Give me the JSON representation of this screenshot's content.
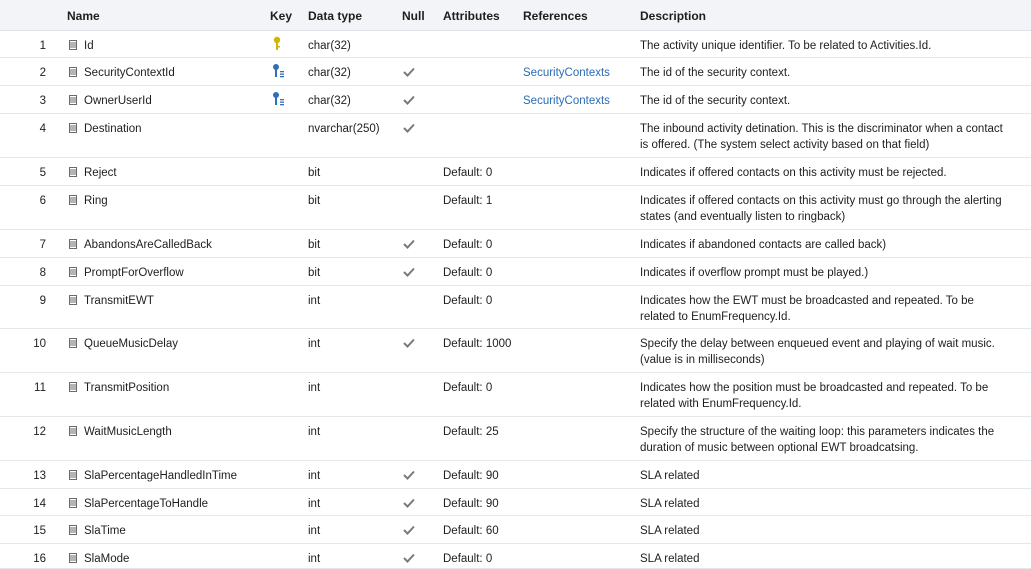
{
  "headers": {
    "name": "Name",
    "key": "Key",
    "data_type": "Data type",
    "null": "Null",
    "attributes": "Attributes",
    "references": "References",
    "description": "Description"
  },
  "rows": [
    {
      "num": "1",
      "name": "Id",
      "key": "primary",
      "type": "char(32)",
      "null": false,
      "attr": "",
      "ref": "",
      "desc": "The activity unique identifier. To be related to Activities.Id."
    },
    {
      "num": "2",
      "name": "SecurityContextId",
      "key": "foreign",
      "type": "char(32)",
      "null": true,
      "attr": "",
      "ref": "SecurityContexts",
      "desc": "The id of the security context."
    },
    {
      "num": "3",
      "name": "OwnerUserId",
      "key": "foreign",
      "type": "char(32)",
      "null": true,
      "attr": "",
      "ref": "SecurityContexts",
      "desc": "The id of the security context."
    },
    {
      "num": "4",
      "name": "Destination",
      "key": "",
      "type": "nvarchar(250)",
      "null": true,
      "attr": "",
      "ref": "",
      "desc": "The inbound activity detination. This is the discriminator when a contact is offered. (The system select activity based on that field)"
    },
    {
      "num": "5",
      "name": "Reject",
      "key": "",
      "type": "bit",
      "null": false,
      "attr": "Default: 0",
      "ref": "",
      "desc": "Indicates if offered contacts on this activity must be rejected."
    },
    {
      "num": "6",
      "name": "Ring",
      "key": "",
      "type": "bit",
      "null": false,
      "attr": "Default: 1",
      "ref": "",
      "desc": "Indicates if offered contacts on this activity must go through the alerting states (and eventually listen to ringback)"
    },
    {
      "num": "7",
      "name": "AbandonsAreCalledBack",
      "key": "",
      "type": "bit",
      "null": true,
      "attr": "Default: 0",
      "ref": "",
      "desc": "Indicates if abandoned contacts are called back)"
    },
    {
      "num": "8",
      "name": "PromptForOverflow",
      "key": "",
      "type": "bit",
      "null": true,
      "attr": "Default: 0",
      "ref": "",
      "desc": "Indicates if overflow prompt must be played.)"
    },
    {
      "num": "9",
      "name": "TransmitEWT",
      "key": "",
      "type": "int",
      "null": false,
      "attr": "Default: 0",
      "ref": "",
      "desc": "Indicates how the EWT must be broadcasted and repeated. To be related to EnumFrequency.Id."
    },
    {
      "num": "10",
      "name": "QueueMusicDelay",
      "key": "",
      "type": "int",
      "null": true,
      "attr": "Default: 1000",
      "ref": "",
      "desc": "Specify the delay between enqueued event and playing of wait music. (value is in milliseconds)"
    },
    {
      "num": "11",
      "name": "TransmitPosition",
      "key": "",
      "type": "int",
      "null": false,
      "attr": "Default: 0",
      "ref": "",
      "desc": "Indicates how the position must be broadcasted and repeated. To be related with EnumFrequency.Id."
    },
    {
      "num": "12",
      "name": "WaitMusicLength",
      "key": "",
      "type": "int",
      "null": false,
      "attr": "Default: 25",
      "ref": "",
      "desc": "Specify the structure of the waiting loop: this parameters indicates the duration of music between optional EWT broadcatsing."
    },
    {
      "num": "13",
      "name": "SlaPercentageHandledInTime",
      "key": "",
      "type": "int",
      "null": true,
      "attr": "Default: 90",
      "ref": "",
      "desc": "SLA related"
    },
    {
      "num": "14",
      "name": "SlaPercentageToHandle",
      "key": "",
      "type": "int",
      "null": true,
      "attr": "Default: 90",
      "ref": "",
      "desc": "SLA related"
    },
    {
      "num": "15",
      "name": "SlaTime",
      "key": "",
      "type": "int",
      "null": true,
      "attr": "Default: 60",
      "ref": "",
      "desc": "SLA related"
    },
    {
      "num": "16",
      "name": "SlaMode",
      "key": "",
      "type": "int",
      "null": true,
      "attr": "Default: 0",
      "ref": "",
      "desc": "SLA related"
    }
  ],
  "colors": {
    "header_bg": "#f3f4f8",
    "link": "#2b6bb3",
    "primary_key": "#d4b400",
    "foreign_key": "#2f6fb8",
    "check": "#7a7a7a"
  }
}
